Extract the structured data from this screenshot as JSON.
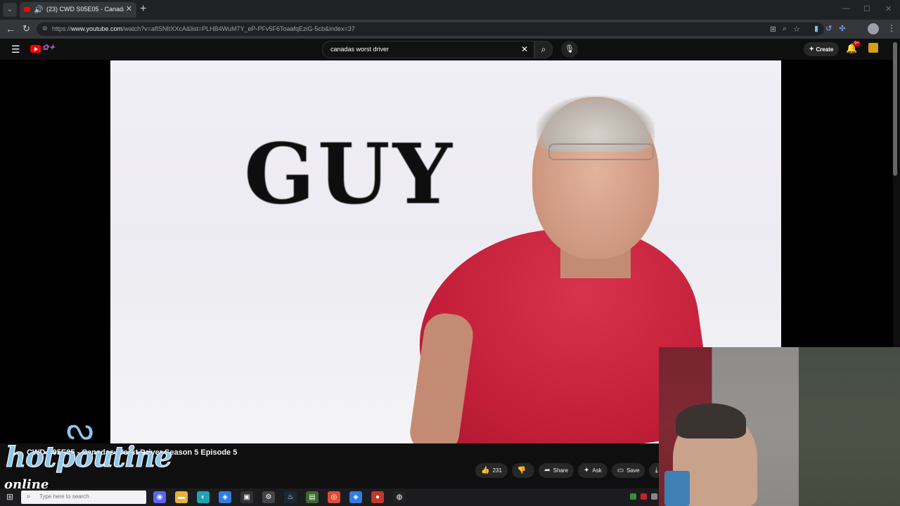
{
  "browser": {
    "tab_title": "(23) CWD S05E05 - Canada's",
    "url_prefix": "https://",
    "url_domain": "www.youtube.com",
    "url_path": "/watch?v=afISNItXXcA&list=PLHB4WuM7Y_eP-PFv5F6ToaafqEziG-5cb&index=37",
    "new_tab_glyph": "+"
  },
  "youtube": {
    "search_query": "canadas worst driver",
    "create_label": "Create",
    "notification_count": "9+"
  },
  "video": {
    "frame_caption": "GUY",
    "title": "CWD S05E05 - Canadas Worst Driver Season 5 Episode 5",
    "like_count": "231",
    "share_label": "Share",
    "ask_label": "Ask",
    "save_label": "Save",
    "download_label": "Do"
  },
  "overlay": {
    "logo_text": "hotpoutine",
    "logo_sub": "online"
  },
  "taskbar": {
    "search_placeholder": "Type here to search"
  },
  "colors": {
    "brand_red": "#ff0000",
    "shirt_red": "#c41f3a",
    "logo_blue": "#8fc8ec"
  }
}
